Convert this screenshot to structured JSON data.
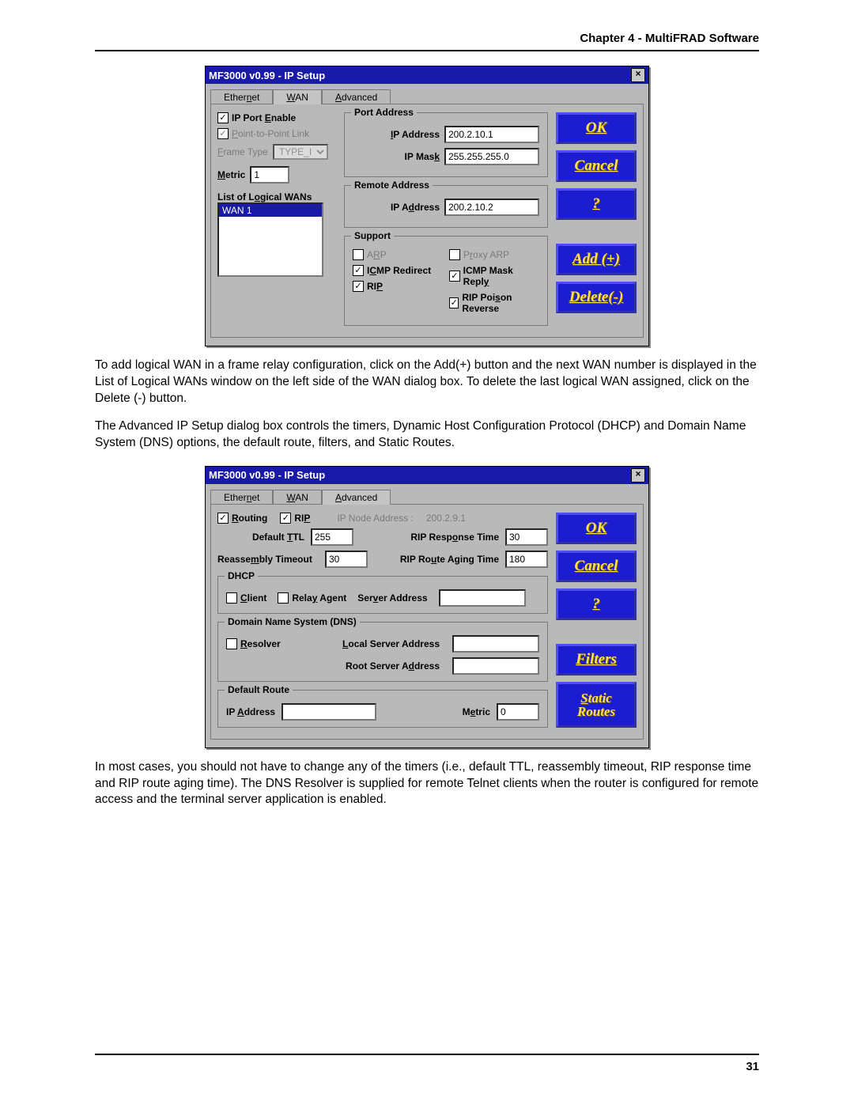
{
  "doc": {
    "chapter_header": "Chapter 4 - MultiFRAD Software",
    "para1": "To add logical WAN in a frame relay configuration, click on the Add(+) button and the next WAN number is displayed in the List of Logical WANs window on the left side of the WAN dialog box.  To delete the last logical WAN assigned, click on the Delete (-) button.",
    "para2": "The Advanced IP Setup dialog box controls the timers, Dynamic Host Configuration Protocol (DHCP) and Domain Name System (DNS) options, the default route, filters, and Static Routes.",
    "para3": "In most cases, you should not have to change any of the timers (i.e., default TTL, reassembly timeout, RIP response time and RIP route aging time).  The DNS Resolver is supplied for remote Telnet clients when the router is configured for remote access and the terminal server application is enabled.",
    "page_number": "31"
  },
  "dialog1": {
    "title": "MF3000 v0.99 - IP Setup",
    "tabs": {
      "ethernet": "Ethernet",
      "wan": "WAN",
      "advanced": "Advanced"
    },
    "left": {
      "ip_port_enable": "IP Port Enable",
      "ptp_link": "Point-to-Point Link",
      "frame_type_label": "Frame Type",
      "frame_type_value": "TYPE_II",
      "metric_label": "Metric",
      "metric_value": "1",
      "list_label": "List of Logical WANs",
      "list_item": "WAN 1"
    },
    "port_addr": {
      "title": "Port Address",
      "ip_label": "IP Address",
      "ip_value": "200.2.10.1",
      "mask_label": "IP Mask",
      "mask_value": "255.255.255.0"
    },
    "remote_addr": {
      "title": "Remote Address",
      "ip_label": "IP Address",
      "ip_value": "200.2.10.2"
    },
    "support": {
      "title": "Support",
      "arp": "ARP",
      "proxy_arp": "Proxy ARP",
      "icmp_redirect": "ICMP Redirect",
      "icmp_mask_reply": "ICMP Mask Reply",
      "rip": "RIP",
      "rip_poison": "RIP Poison Reverse"
    },
    "buttons": {
      "ok": "OK",
      "cancel": "Cancel",
      "add": "Add (+)",
      "delete": "Delete(-)"
    }
  },
  "dialog2": {
    "title": "MF3000 v0.99 - IP Setup",
    "tabs": {
      "ethernet": "Ethernet",
      "wan": "WAN",
      "advanced": "Advanced"
    },
    "top": {
      "routing": "Routing",
      "rip": "RIP",
      "ip_node_label": "IP Node Address :",
      "ip_node_value": "200.2.9.1",
      "default_ttl_label": "Default TTL",
      "default_ttl_value": "255",
      "rip_response_label": "RIP Response Time",
      "rip_response_value": "30",
      "reassembly_label": "Reassembly Timeout",
      "reassembly_value": "30",
      "rip_aging_label": "RIP Route Aging Time",
      "rip_aging_value": "180"
    },
    "dhcp": {
      "title": "DHCP",
      "client": "Client",
      "relay": "Relay Agent",
      "server_addr_label": "Server Address"
    },
    "dns": {
      "title": "Domain Name System (DNS)",
      "resolver": "Resolver",
      "local_label": "Local Server Address",
      "root_label": "Root Server Address"
    },
    "default_route": {
      "title": "Default Route",
      "ip_label": "IP Address",
      "metric_label": "Metric",
      "metric_value": "0"
    },
    "buttons": {
      "ok": "OK",
      "cancel": "Cancel",
      "filters": "Filters",
      "static_routes": "Static Routes"
    }
  }
}
